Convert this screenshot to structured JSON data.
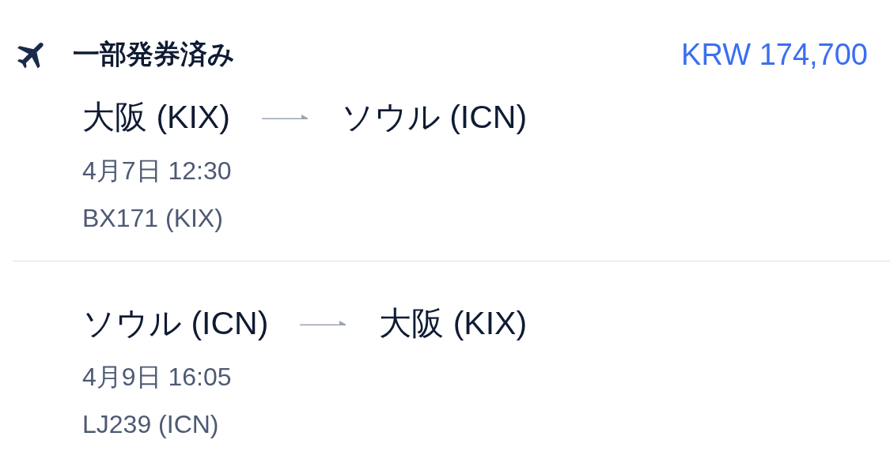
{
  "header": {
    "status": "一部発券済み",
    "price": "KRW 174,700"
  },
  "flights": [
    {
      "origin": "大阪 (KIX)",
      "destination": "ソウル (ICN)",
      "datetime": "4月7日 12:30",
      "flight": "BX171 (KIX)"
    },
    {
      "origin": "ソウル (ICN)",
      "destination": "大阪 (KIX)",
      "datetime": "4月9日 16:05",
      "flight": "LJ239 (ICN)"
    }
  ]
}
